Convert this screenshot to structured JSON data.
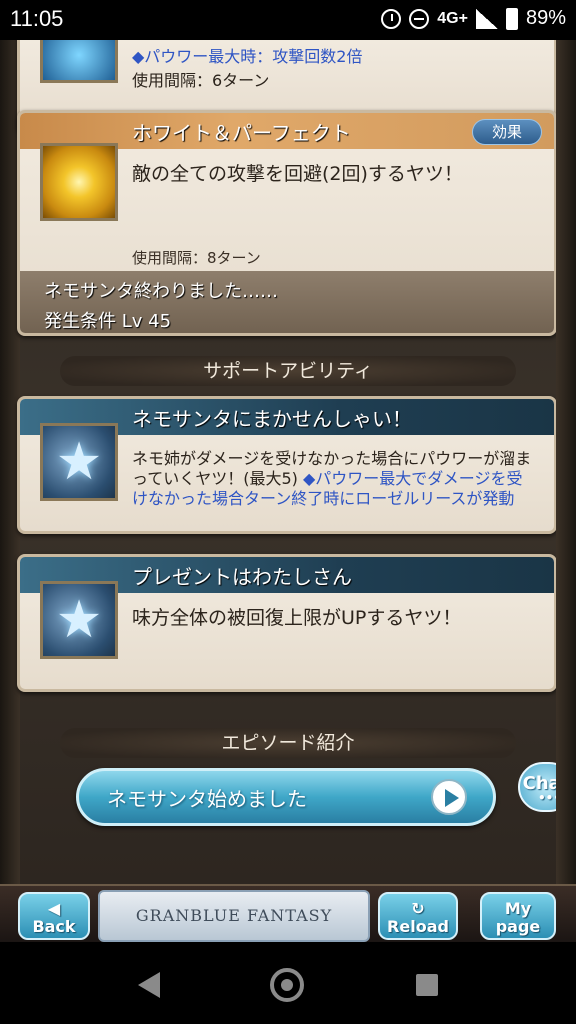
{
  "status_bar": {
    "time": "11:05",
    "network": "4G+",
    "battery": "89%",
    "icons": [
      "alarm-icon",
      "do-not-disturb-icon",
      "signal-icon",
      "battery-icon"
    ]
  },
  "prev_card": {
    "line1": "◆パウワー最大時：攻撃回数2倍",
    "line2": "使用間隔：6ターン"
  },
  "skill_card": {
    "title": "ホワイト＆パーフェクト",
    "effect_button": "効果",
    "description": "敵の全ての攻撃を回避(2回)するヤツ！",
    "usage": "使用間隔：8ターン",
    "condition_text": "ネモサンタ終わりました……",
    "condition_level": "発生条件 Lv 45"
  },
  "support_section": {
    "label": "サポートアビリティ",
    "items": [
      {
        "title": "ネモサンタにまかせんしゃい！",
        "desc_black": "ネモ姉がダメージを受けなかった場合にパウワーが溜まっていくヤツ！(最大5)",
        "desc_blue": "◆パウワー最大でダメージを受けなかった場合ターン終了時にローゼルリースが発動"
      },
      {
        "title": "プレゼントはわたしさん",
        "desc_black": "味方全体の被回復上限がUPするヤツ！",
        "desc_blue": ""
      }
    ]
  },
  "episode_section": {
    "label": "エピソード紹介",
    "button_label": "ネモサンタ始めました"
  },
  "chat_button": "Chat",
  "bottom_nav": {
    "back": "Back",
    "logo": "GRANBLUE FANTASY",
    "reload": "Reload",
    "mypage_line1": "My",
    "mypage_line2": "page"
  }
}
